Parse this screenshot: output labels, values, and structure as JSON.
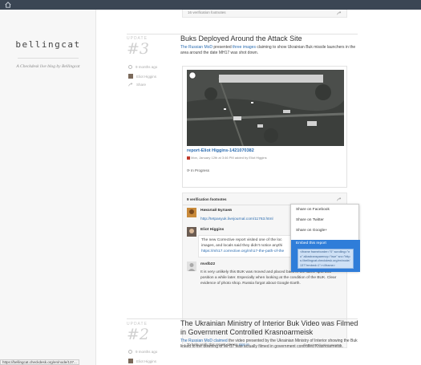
{
  "sidebar": {
    "logo": "bellingcat",
    "tagline": "A Checkdesk live blog by Bellingcat"
  },
  "status_url": "https://bellingcat.checkdesk.org/en/node/137...",
  "top_footnotes": "16 verification footnotes",
  "update3": {
    "label": "UPDATE",
    "number": "#3",
    "time": "9 months ago",
    "author": "Eliot Higgins",
    "share": "Share",
    "title": "Buks Deployed Around the Attack Site",
    "body_link1": "The Russian MoD",
    "body_mid": " presented ",
    "body_link2": "three images",
    "body_rest": " claiming to show Ukrainian Buk missile launchers in the area around the date MH17 was shot down.",
    "report_title": "report-Eliot Higgins-1421070382",
    "report_meta": "Mon, January 12th at 3:46 PM added by Eliot Higgins",
    "report_status": "In Progress",
    "footnotes_header": "9 verification footnotes",
    "footnotes": [
      {
        "name": "Николай Буланв",
        "text": "http://tetpasyuk.livejournal.com/11763.html"
      },
      {
        "name": "Eliot Higgins",
        "text1": "The new Corrective report visited one of the loc",
        "text2": "images, and locals said they didn't notice anythi",
        "link": "https://mh17.corrective.org/mh17-the-path-of-the"
      },
      {
        "name": "mvdb22",
        "time": "Jan 12",
        "text": "It is very unlikely this BUK was moved and placed back in the same spot and position a while later. Especially when looking at the condition of the BUK. Clear evidence of photo shop. Russia forgot about Google Earth."
      }
    ],
    "help_text": "To help verify this report, please ",
    "help_link": "sign in",
    "report_verify": "Report verification process"
  },
  "share_menu": {
    "items": [
      "Share on Facebook",
      "Share on Twitter",
      "Share on Google+"
    ],
    "embed_label": "Embed this report",
    "embed_code": "<iframe frameborder=\"0\" scrolling=\"no\" allowtransparency=\"true\" src=\"https://bellingcat.checkdesk.org/en/node/137?embed=1\"></iframe>"
  },
  "update2": {
    "label": "UPDATE",
    "number": "#2",
    "time": "9 months ago",
    "author": "Eliot Higgins",
    "title": "The Ukrainian Ministry of Interior Buk Video was Filmed in Government Controlled Krasnoarmeisk",
    "body_link": "The Russian MoD",
    "body_mid": " ",
    "body_link2": "claimed",
    "body_rest": " the video presented by the Ukrainian Ministry of Interior showing the Buk linked to the downing of MH17 was actually filmed in government controlled Krasnoarmeisk."
  },
  "colors": {
    "topbar": "#3b4654",
    "link": "#2b6cb0",
    "highlight": "#2f7dd9"
  }
}
